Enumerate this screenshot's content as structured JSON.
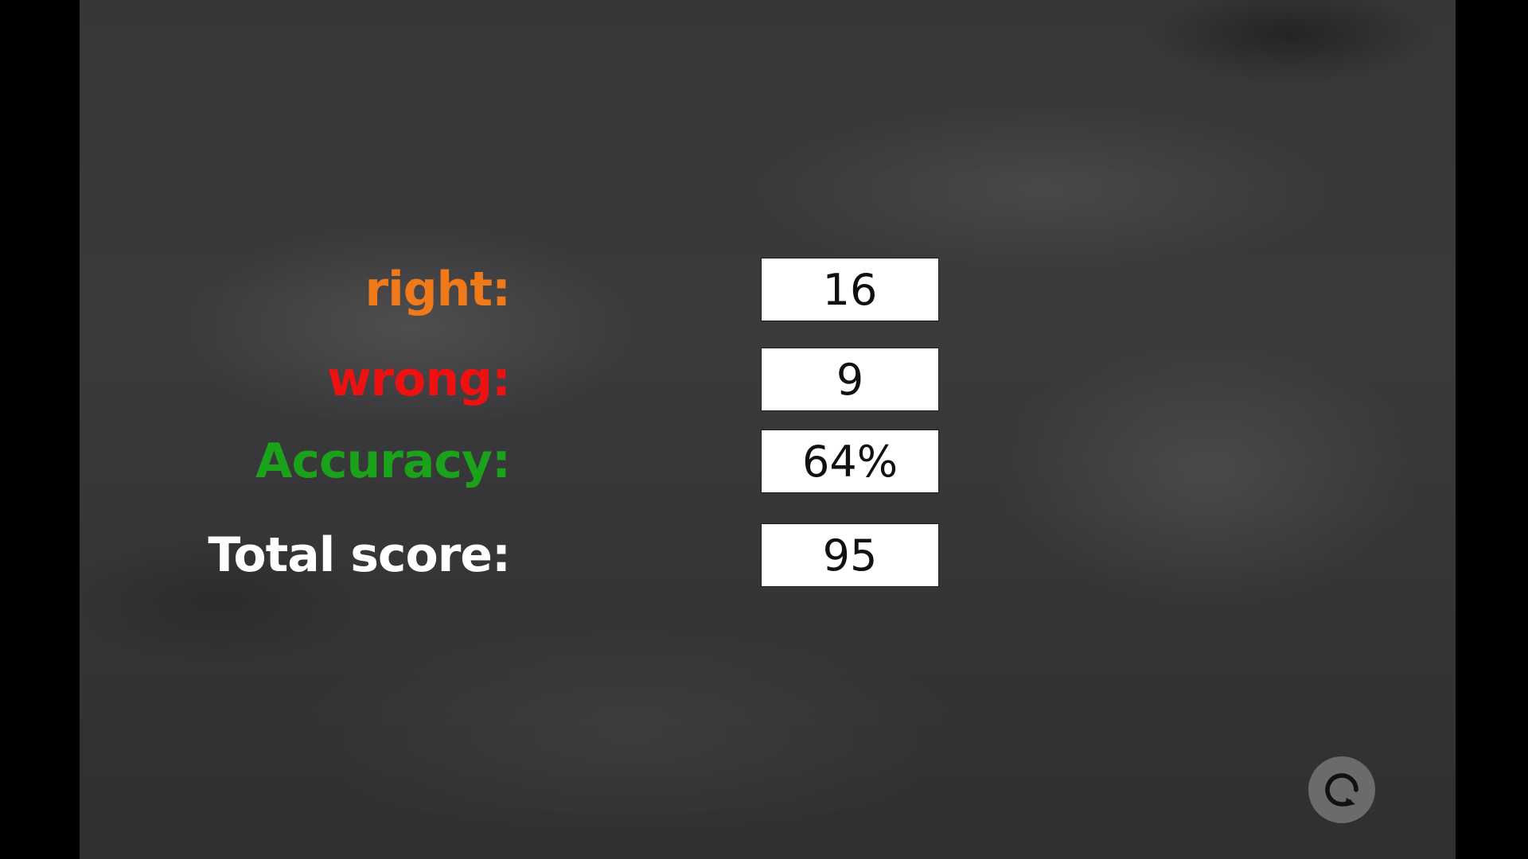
{
  "colors": {
    "right": "#f07a1a",
    "wrong": "#ee1111",
    "accuracy": "#1aa31a",
    "total": "#ffffff",
    "background": "#3a3a3c"
  },
  "results": {
    "right": {
      "label": "right:",
      "value": "16"
    },
    "wrong": {
      "label": "wrong:",
      "value": "9"
    },
    "accuracy": {
      "label": "Accuracy:",
      "value": "64%"
    },
    "total": {
      "label": "Total score:",
      "value": "95"
    }
  },
  "controls": {
    "replay_icon": "refresh-icon"
  }
}
